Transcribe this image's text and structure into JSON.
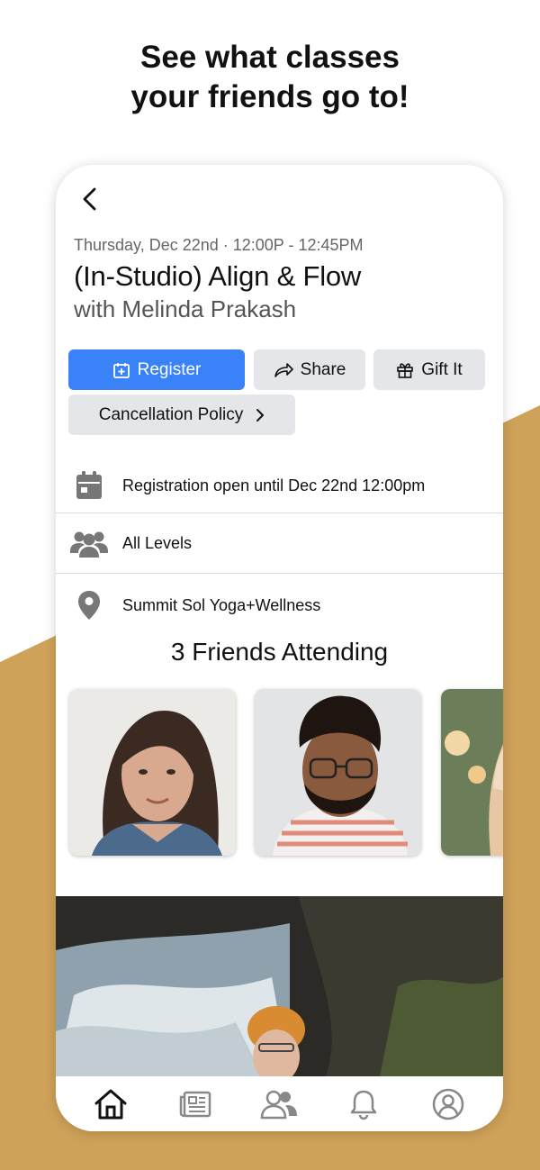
{
  "colors": {
    "accent": "#3a82f7",
    "background_shape": "#cfa259",
    "button_gray": "#e4e6e9"
  },
  "headline": {
    "line1": "See what classes",
    "line2": "your friends go to!"
  },
  "class": {
    "date_time": "Thursday, Dec 22nd · 12:00P - 12:45PM",
    "title": "(In-Studio) Align & Flow",
    "instructor": "with Melinda Prakash"
  },
  "actions": {
    "register_label": "Register",
    "register_icon": "calendar-plus-icon",
    "share_label": "Share",
    "share_icon": "share-arrow-icon",
    "gift_label": "Gift It",
    "gift_icon": "gift-icon",
    "policy_label": "Cancellation Policy",
    "policy_icon": "chevron-right-icon"
  },
  "details": {
    "registration": {
      "icon": "calendar-icon",
      "text": "Registration open until Dec 22nd 12:00pm"
    },
    "level": {
      "icon": "people-icon",
      "text": "All Levels"
    },
    "location": {
      "icon": "location-pin-icon",
      "text": "Summit Sol Yoga+Wellness"
    }
  },
  "friends": {
    "title": "3 Friends Attending",
    "avatars": [
      "friend-photo-woman-icon",
      "friend-photo-man-icon",
      "friend-photo-partial-icon"
    ]
  },
  "tabbar": {
    "items": [
      "home-icon",
      "news-icon",
      "friends-icon",
      "bell-icon",
      "profile-icon"
    ],
    "active": "home-icon"
  }
}
